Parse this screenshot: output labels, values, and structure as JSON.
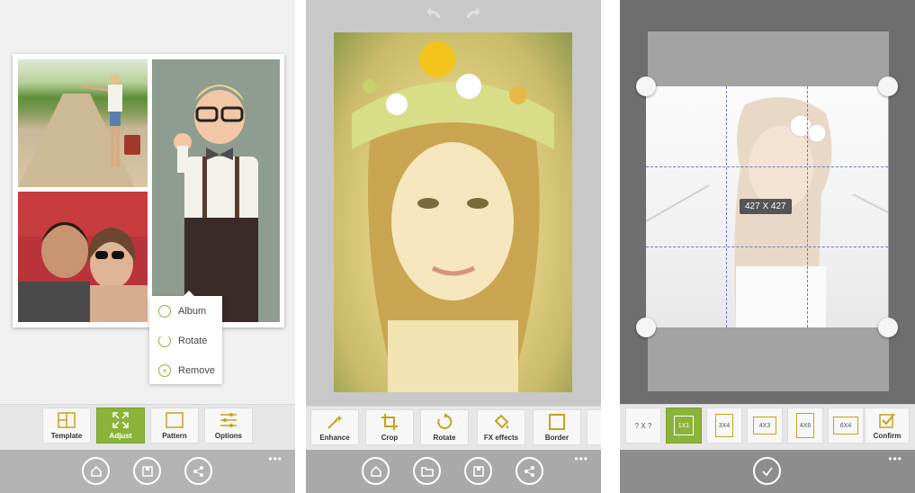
{
  "screen1": {
    "popup": {
      "album": "Album",
      "rotate": "Rotate",
      "remove": "Remove"
    },
    "toolbar": [
      {
        "label": "Template",
        "icon": "template-icon"
      },
      {
        "label": "Adjust",
        "icon": "adjust-icon",
        "active": true
      },
      {
        "label": "Pattern",
        "icon": "pattern-icon"
      },
      {
        "label": "Options",
        "icon": "options-icon"
      }
    ],
    "appbar": [
      "home-icon",
      "save-icon",
      "share-icon"
    ],
    "more": "•••"
  },
  "screen2": {
    "toolbar": [
      {
        "label": "Enhance",
        "icon": "wand-icon"
      },
      {
        "label": "Crop",
        "icon": "crop-icon"
      },
      {
        "label": "Rotate",
        "icon": "rotate-icon"
      },
      {
        "label": "FX effects",
        "icon": "fx-effects-icon"
      },
      {
        "label": "Border",
        "icon": "border-icon"
      }
    ],
    "appbar": [
      "home-icon",
      "folder-icon",
      "save-icon",
      "share-icon"
    ],
    "more": "•••"
  },
  "screen3": {
    "size_label": "427 X 427",
    "ratios": [
      {
        "label": "? X ?"
      },
      {
        "label": "1X1",
        "active": true
      },
      {
        "label": "3X4"
      },
      {
        "label": "4X3"
      },
      {
        "label": "4X6"
      },
      {
        "label": "6X4"
      }
    ],
    "confirm": "Confirm",
    "appbar": [
      "check-icon"
    ],
    "more": "•••"
  },
  "colors": {
    "accent": "#8ab33a",
    "ratio_border": "#c7a21c",
    "appbar": "#a9a9a9"
  }
}
